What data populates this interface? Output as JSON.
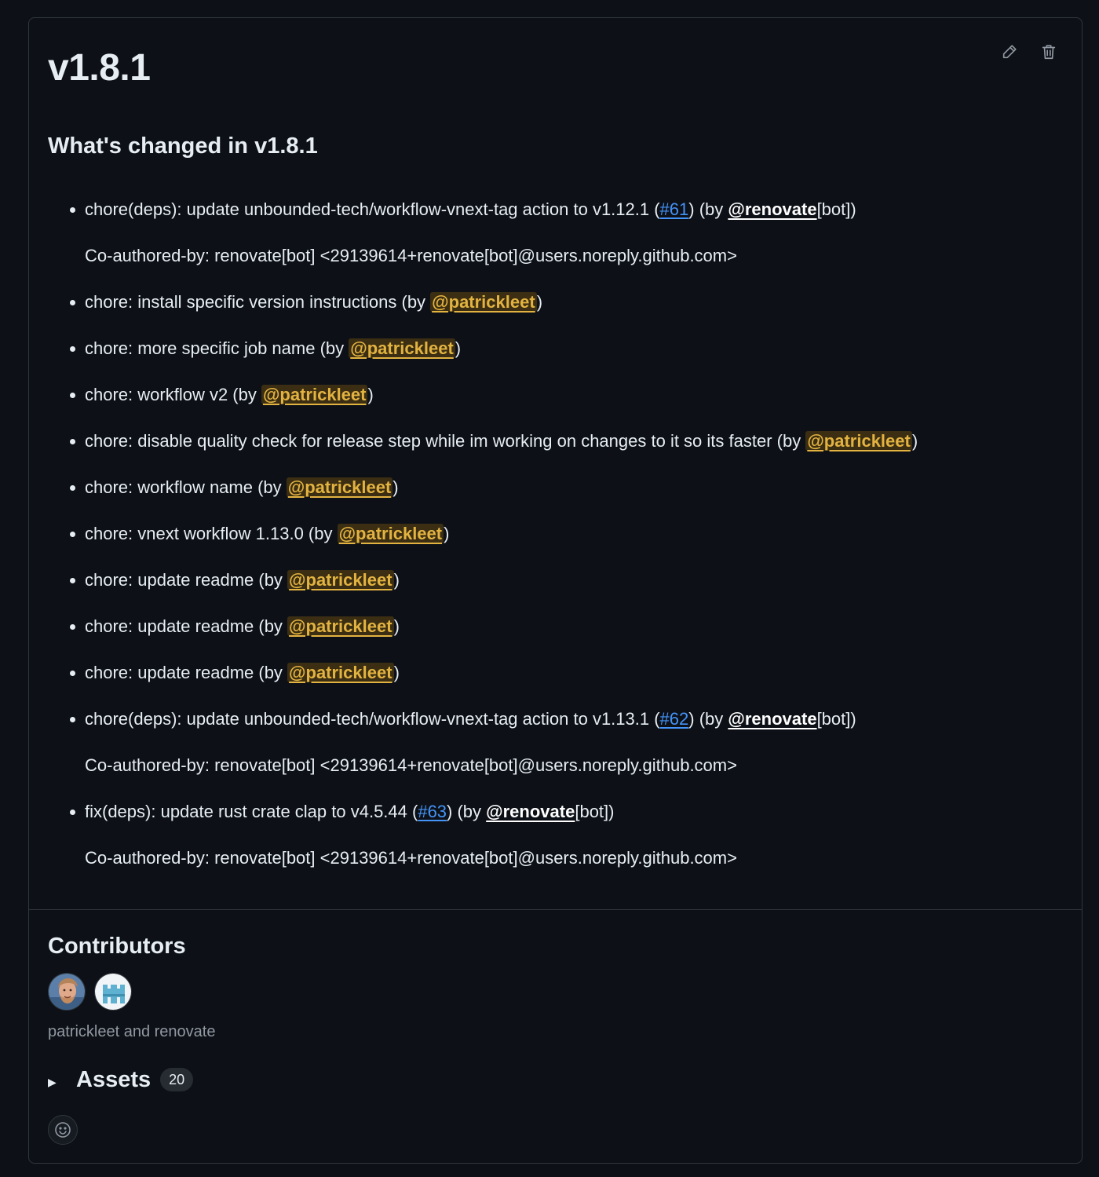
{
  "release": {
    "title": "v1.8.1",
    "actions": {
      "edit_icon": "pencil-icon",
      "delete_icon": "trash-icon"
    }
  },
  "changes": {
    "heading": "What's changed in v1.8.1",
    "items": [
      {
        "text": "chore(deps): update unbounded-tech/workflow-vnext-tag action to v1.12.1 (",
        "issue": "#61",
        "mid": ") (by ",
        "user": "@renovate",
        "tail": "[bot])",
        "coauthor": "Co-authored-by: renovate[bot] <29139614+renovate[bot]@users.noreply.github.com>"
      },
      {
        "text": "chore: install specific version instructions (by ",
        "mention": "@patrickleet",
        "tail": ")"
      },
      {
        "text": "chore: more specific job name (by ",
        "mention": "@patrickleet",
        "tail": ")"
      },
      {
        "text": "chore: workflow v2 (by ",
        "mention": "@patrickleet",
        "tail": ")"
      },
      {
        "text": "chore: disable quality check for release step while im working on changes to it so its faster (by ",
        "mention": "@patrickleet",
        "tail": ")"
      },
      {
        "text": "chore: workflow name (by ",
        "mention": "@patrickleet",
        "tail": ")"
      },
      {
        "text": "chore: vnext workflow 1.13.0 (by ",
        "mention": "@patrickleet",
        "tail": ")"
      },
      {
        "text": "chore: update readme (by ",
        "mention": "@patrickleet",
        "tail": ")"
      },
      {
        "text": "chore: update readme (by ",
        "mention": "@patrickleet",
        "tail": ")"
      },
      {
        "text": "chore: update readme (by ",
        "mention": "@patrickleet",
        "tail": ")"
      },
      {
        "text": "chore(deps): update unbounded-tech/workflow-vnext-tag action to v1.13.1 (",
        "issue": "#62",
        "mid": ") (by ",
        "user": "@renovate",
        "tail": "[bot])",
        "coauthor": "Co-authored-by: renovate[bot] <29139614+renovate[bot]@users.noreply.github.com>"
      },
      {
        "text": "fix(deps): update rust crate clap to v4.5.44 (",
        "issue": "#63",
        "mid": ") (by ",
        "user": "@renovate",
        "tail": "[bot])",
        "coauthor": "Co-authored-by: renovate[bot] <29139614+renovate[bot]@users.noreply.github.com>"
      }
    ]
  },
  "contributors": {
    "heading": "Contributors",
    "avatars": [
      "patrickleet-avatar",
      "renovate-avatar"
    ],
    "names": "patrickleet and renovate"
  },
  "assets": {
    "label": "Assets",
    "count": "20",
    "caret_icon": "triangle-right-icon"
  },
  "reactions": {
    "icon": "smiley-icon"
  },
  "colors": {
    "background": "#0d1117",
    "border": "#30363d",
    "link": "#4493f8",
    "mention": "#e3b341",
    "mention_bg": "#3b2e12",
    "muted": "#9198a1"
  }
}
